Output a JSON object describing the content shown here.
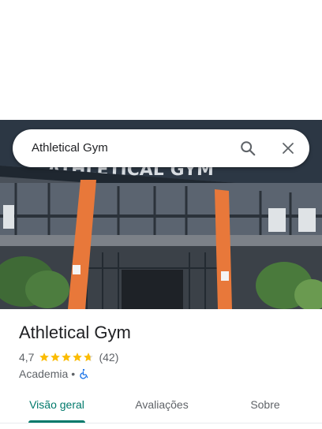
{
  "search": {
    "query": "Athletical Gym",
    "search_icon": "search-icon",
    "close_icon": "close-icon"
  },
  "photo": {
    "sign_text": "ATHLETICAL GYM"
  },
  "place": {
    "name": "Athletical Gym",
    "rating": "4,7",
    "rating_value": 4.7,
    "rating_max": 5,
    "review_count": "(42)",
    "category": "Academia",
    "separator": "•",
    "accessibility_icon": "wheelchair-icon"
  },
  "tabs": [
    {
      "label": "Visão geral",
      "active": true
    },
    {
      "label": "Avaliações",
      "active": false
    },
    {
      "label": "Sobre",
      "active": false
    }
  ],
  "colors": {
    "accent": "#00796b",
    "star": "#fbbc04",
    "accessibility": "#1a73e8",
    "sign_orange": "#e8783a"
  }
}
